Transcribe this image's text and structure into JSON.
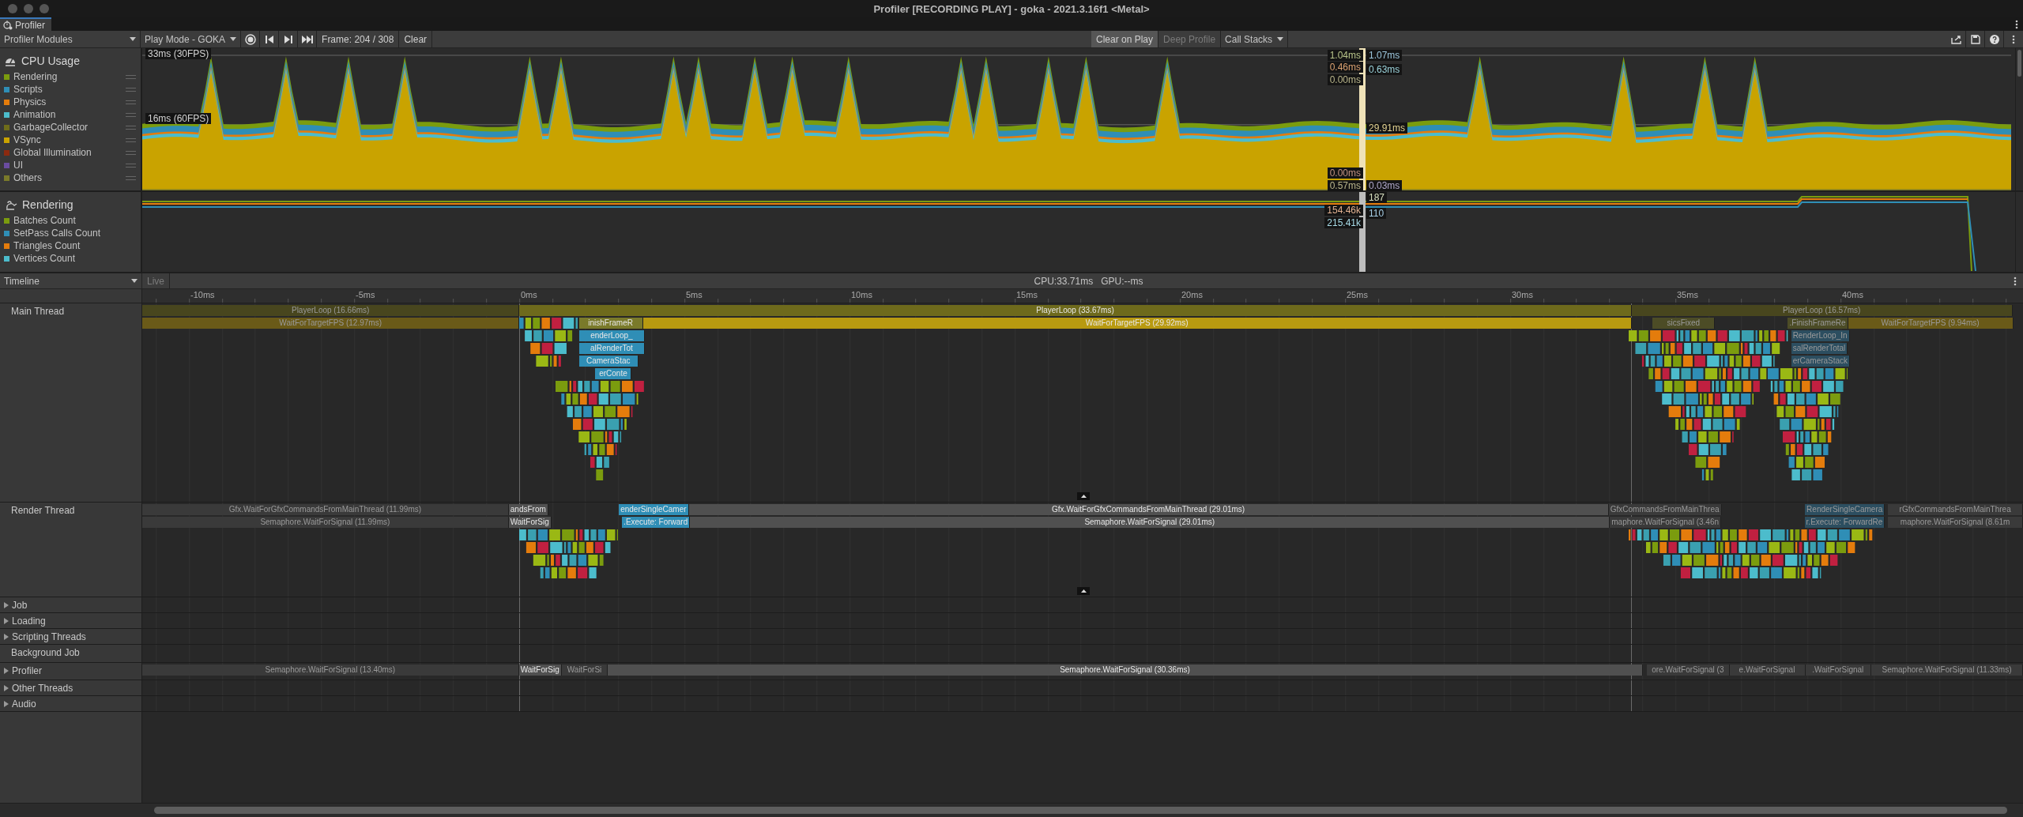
{
  "window": {
    "title": "Profiler [RECORDING PLAY] - goka - 2021.3.16f1 <Metal>"
  },
  "tabs": [
    {
      "label": "Profiler",
      "selected": true
    }
  ],
  "toolbar": {
    "modules": "Profiler Modules",
    "target": "Play Mode - GOKA",
    "frame": "Frame: 204 / 308",
    "clear": "Clear",
    "toggles": [
      {
        "label": "Clear on Play",
        "on": true,
        "disabled": false
      },
      {
        "label": "Deep Profile",
        "on": false,
        "disabled": true
      }
    ],
    "call_stacks": "Call Stacks"
  },
  "modules": [
    {
      "kind": "cpu",
      "title": "CPU Usage",
      "thresholds": [
        "33ms (30FPS)",
        "16ms (60FPS)"
      ],
      "legend": [
        {
          "label": "Rendering",
          "color": "#7b9c0e"
        },
        {
          "label": "Scripts",
          "color": "#2f8eb6"
        },
        {
          "label": "Physics",
          "color": "#e47c0c"
        },
        {
          "label": "Animation",
          "color": "#4cbccc"
        },
        {
          "label": "GarbageCollector",
          "color": "#6e6c1a"
        },
        {
          "label": "VSync",
          "color": "#c9a300"
        },
        {
          "label": "Global Illumination",
          "color": "#8c2a10"
        },
        {
          "label": "UI",
          "color": "#6a4ca0"
        },
        {
          "label": "Others",
          "color": "#7a7a2a"
        }
      ],
      "readouts": [
        "1.04ms",
        "1.07ms",
        "0.46ms",
        "0.63ms",
        "0.00ms",
        "29.91ms",
        "0.00ms",
        "0.57ms",
        "0.03ms"
      ]
    },
    {
      "kind": "rendering",
      "title": "Rendering",
      "legend": [
        {
          "label": "Batches Count",
          "color": "#7b9c0e"
        },
        {
          "label": "SetPass Calls Count",
          "color": "#2f8eb6"
        },
        {
          "label": "Triangles Count",
          "color": "#e47c0c"
        },
        {
          "label": "Vertices Count",
          "color": "#4cbccc"
        }
      ],
      "readouts": [
        "187",
        "154.46k",
        "110",
        "215.41k"
      ]
    }
  ],
  "timeline": {
    "view": "Timeline",
    "live": {
      "label": "Live",
      "disabled": true
    },
    "cpu": "CPU:33.71ms",
    "gpu": "GPU:--ms",
    "ruler": [
      "-10ms",
      "-5ms",
      "0ms",
      "5ms",
      "10ms",
      "15ms",
      "20ms",
      "25ms",
      "30ms",
      "35ms",
      "40ms"
    ],
    "threads": [
      {
        "kind": "thread",
        "name": "Main Thread",
        "lanes": [
          [
            {
              "label": "PlayerLoop (16.66ms)",
              "color": "#48461e",
              "dim": true
            },
            {
              "label": "PlayerLoop (33.67ms)",
              "color": "#6e6a1c",
              "dim": false
            },
            {
              "label": "PlayerLoop (16.57ms)",
              "color": "#48461e",
              "dim": true
            }
          ],
          [
            {
              "label": "WaitForTargetFPS (12.97ms)",
              "color": "#6a5a18",
              "dim": true
            },
            {
              "label": "inishFrameR",
              "color": "#7a7a2a",
              "dim": false
            },
            {
              "label": "WaitForTargetFPS (29.92ms)",
              "color": "#b89a10",
              "dim": false
            },
            {
              "label": "sicsFixed",
              "color": "#4c4c26",
              "dim": true
            },
            {
              "label": ".FinishFrameRe",
              "color": "#4c4c26",
              "dim": true
            },
            {
              "label": "WaitForTargetFPS (9.94ms)",
              "color": "#6a5a18",
              "dim": true
            }
          ],
          [
            {
              "label": "enderLoop_",
              "color": "#2f8eb6",
              "dim": false
            },
            {
              "label": "RenderLoop_In",
              "color": "#2c4e60",
              "dim": true
            }
          ],
          [
            {
              "label": "alRenderTot",
              "color": "#2f8eb6",
              "dim": false
            },
            {
              "label": "salRenderTotal",
              "color": "#2c4e60",
              "dim": true
            }
          ],
          [
            {
              "label": "CameraStac",
              "color": "#2f8eb6",
              "dim": false
            },
            {
              "label": "erCameraStack",
              "color": "#2c4e60",
              "dim": true
            }
          ],
          [
            {
              "label": "erConte",
              "color": "#2f8eb6",
              "dim": false
            }
          ]
        ]
      },
      {
        "kind": "thread",
        "name": "Render Thread",
        "lanes": [
          [
            {
              "label": "Gfx.WaitForGfxCommandsFromMainThread (11.99ms)",
              "color": "#3a3a3a",
              "dim": true
            },
            {
              "label": "andsFrom",
              "color": "#505050",
              "dim": false
            },
            {
              "label": "enderSingleCamer",
              "color": "#2f8eb6",
              "dim": false
            },
            {
              "label": "Gfx.WaitForGfxCommandsFromMainThread (29.01ms)",
              "color": "#505050",
              "dim": false
            },
            {
              "label": "GfxCommandsFromMainThrea",
              "color": "#3a3a3a",
              "dim": true
            },
            {
              "label": "RenderSingleCamera",
              "color": "#2c4e60",
              "dim": true
            },
            {
              "label": "rGfxCommandsFromMainThrea",
              "color": "#3a3a3a",
              "dim": true
            }
          ],
          [
            {
              "label": "Semaphore.WaitForSignal (11.99ms)",
              "color": "#3a3a3a",
              "dim": true
            },
            {
              "label": "WaitForSig",
              "color": "#505050",
              "dim": false
            },
            {
              "label": ".Execute: Forward",
              "color": "#2f8eb6",
              "dim": false
            },
            {
              "label": "Semaphore.WaitForSignal (29.01ms)",
              "color": "#505050",
              "dim": false
            },
            {
              "label": "maphore.WaitForSignal (3.46n",
              "color": "#3a3a3a",
              "dim": true
            },
            {
              "label": "r.Execute: ForwardRe",
              "color": "#2c4e60",
              "dim": true
            },
            {
              "label": "maphore.WaitForSignal (8.61m",
              "color": "#3a3a3a",
              "dim": true
            }
          ]
        ]
      },
      {
        "kind": "group",
        "name": "Job",
        "expanded": false
      },
      {
        "kind": "group",
        "name": "Loading",
        "expanded": false
      },
      {
        "kind": "group",
        "name": "Scripting Threads",
        "expanded": false
      },
      {
        "kind": "thread",
        "name": "Background Job"
      },
      {
        "kind": "group",
        "name": "Profiler",
        "expanded": false,
        "lanes": [
          [
            {
              "label": "Semaphore.WaitForSignal (13.40ms)",
              "color": "#3a3a3a",
              "dim": true
            },
            {
              "label": "WaitForSig",
              "color": "#505050",
              "dim": false
            },
            {
              "label": "WaitForSi",
              "color": "#3a3a3a",
              "dim": true
            },
            {
              "label": "Semaphore.WaitForSignal (30.36ms)",
              "color": "#505050",
              "dim": false
            },
            {
              "label": "ore.WaitForSignal (3",
              "color": "#3a3a3a",
              "dim": true
            },
            {
              "label": "e.WaitForSignal",
              "color": "#3a3a3a",
              "dim": true
            },
            {
              "label": ".WaitForSignal",
              "color": "#3a3a3a",
              "dim": true
            },
            {
              "label": "Semaphore.WaitForSignal (11.33ms)",
              "color": "#3a3a3a",
              "dim": true
            }
          ]
        ]
      },
      {
        "kind": "group",
        "name": "Other Threads",
        "expanded": false
      },
      {
        "kind": "group",
        "name": "Audio",
        "expanded": false
      }
    ]
  }
}
